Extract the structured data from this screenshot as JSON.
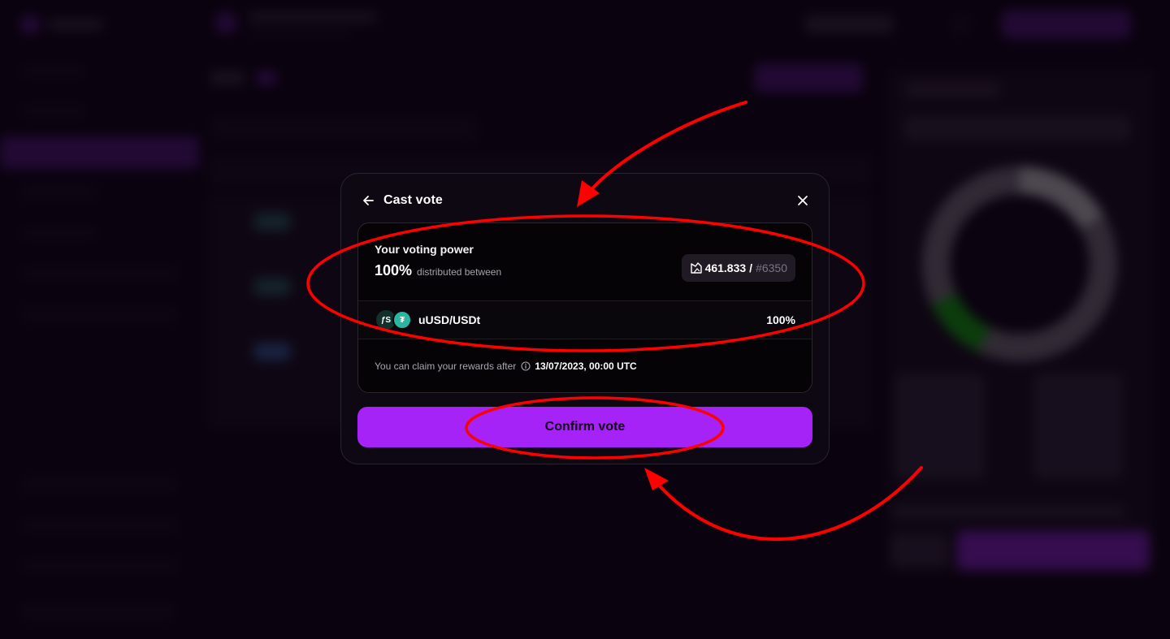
{
  "modal": {
    "title": "Cast vote",
    "voting_power": {
      "label": "Your voting power",
      "percent": "100%",
      "distributed_text": "distributed between",
      "amount": "461.833",
      "separator": "/",
      "nft_id": "#6350"
    },
    "pair": {
      "name": "uUSD/USDt",
      "percent": "100%",
      "token_a_symbol": "ƒS",
      "token_b_symbol": "₮"
    },
    "claim": {
      "text": "You can claim your rewards after",
      "date": "13/07/2023, 00:00 UTC"
    },
    "confirm_label": "Confirm vote"
  },
  "colors": {
    "accent": "#a523f7",
    "annotation": "#ff0000",
    "modal_bg": "#0e0812"
  },
  "icons": [
    "back-arrow-icon",
    "close-icon",
    "nft-icon",
    "info-icon"
  ]
}
